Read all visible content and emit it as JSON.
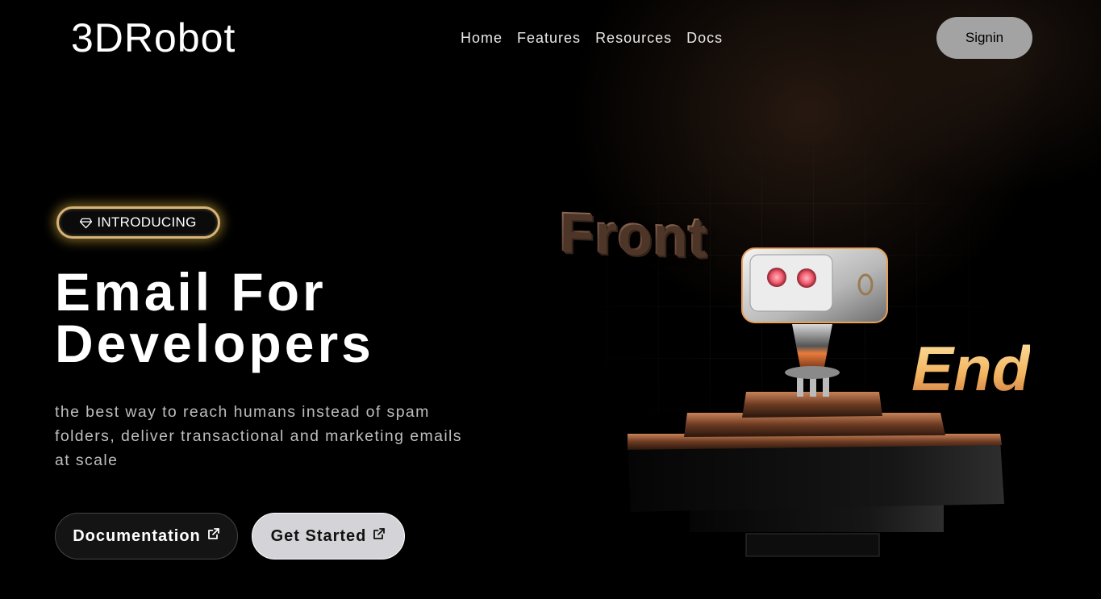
{
  "header": {
    "logo": "3DRobot",
    "nav": [
      "Home",
      "Features",
      "Resources",
      "Docs"
    ],
    "signin_label": "Signin"
  },
  "hero": {
    "badge_label": "INTRODUCING",
    "headline_line1": "Email For",
    "headline_line2": "Developers",
    "subtext": "the best way to reach humans instead of spam folders, deliver transactional and marketing emails at scale",
    "documentation_label": "Documentation",
    "get_started_label": "Get Started"
  },
  "illustration": {
    "word_front": "Front",
    "word_end": "End"
  },
  "icons": {
    "badge": "diamond-icon",
    "external": "external-link-icon"
  },
  "colors": {
    "background": "#000000",
    "badge_border": "#d6b37a",
    "signin_bg": "#a3a3a3",
    "get_started_bg": "#d4d4d8",
    "accent_orange": "#e2874a"
  }
}
